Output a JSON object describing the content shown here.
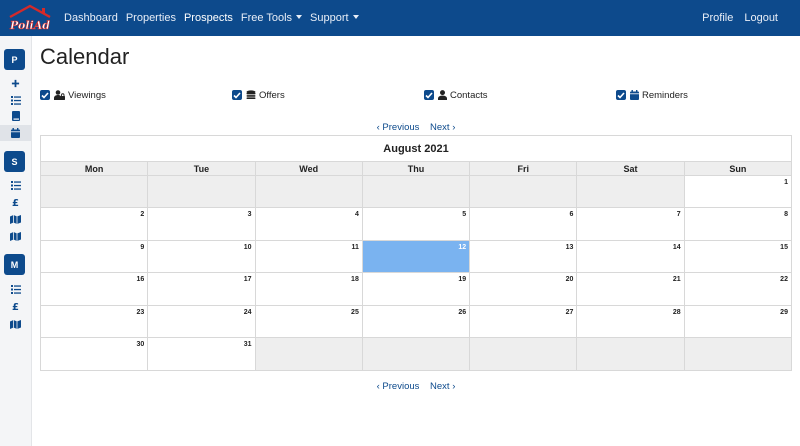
{
  "brand": {
    "logo_text": "PoliAd",
    "accent": "#0d4a8c",
    "logo_color": "#d42a2a"
  },
  "nav": {
    "left": [
      {
        "label": "Dashboard",
        "dropdown": false,
        "active": false
      },
      {
        "label": "Properties",
        "dropdown": false,
        "active": false
      },
      {
        "label": "Prospects",
        "dropdown": false,
        "active": true
      },
      {
        "label": "Free Tools",
        "dropdown": true,
        "active": false
      },
      {
        "label": "Support",
        "dropdown": true,
        "active": false
      }
    ],
    "right": [
      {
        "label": "Profile"
      },
      {
        "label": "Logout"
      }
    ]
  },
  "sidebar": {
    "groups": [
      {
        "label": "P",
        "icons": [
          "plus-icon",
          "list-icon",
          "book-icon",
          "calendar-icon"
        ]
      },
      {
        "label": "S",
        "icons": [
          "list-icon",
          "pound-icon",
          "map-icon",
          "map-icon"
        ]
      },
      {
        "label": "M",
        "icons": [
          "list-icon",
          "pound-icon",
          "map-icon"
        ]
      }
    ],
    "active_icon": "calendar-icon"
  },
  "page": {
    "title": "Calendar"
  },
  "filters": [
    {
      "label": "Viewings",
      "icon": "user-lock-icon",
      "checked": true
    },
    {
      "label": "Offers",
      "icon": "coins-icon",
      "checked": true
    },
    {
      "label": "Contacts",
      "icon": "user-icon",
      "checked": true
    },
    {
      "label": "Reminders",
      "icon": "calendar-icon",
      "checked": true
    }
  ],
  "pager": {
    "prev": "‹ Previous",
    "next": "Next ›"
  },
  "calendar": {
    "month_label": "August 2021",
    "weekdays": [
      "Mon",
      "Tue",
      "Wed",
      "Thu",
      "Fri",
      "Sat",
      "Sun"
    ],
    "weeks": [
      [
        "",
        "",
        "",
        "",
        "",
        "",
        "1"
      ],
      [
        "2",
        "3",
        "4",
        "5",
        "6",
        "7",
        "8"
      ],
      [
        "9",
        "10",
        "11",
        "12",
        "13",
        "14",
        "15"
      ],
      [
        "16",
        "17",
        "18",
        "19",
        "20",
        "21",
        "22"
      ],
      [
        "23",
        "24",
        "25",
        "26",
        "27",
        "28",
        "29"
      ],
      [
        "30",
        "31",
        "",
        "",
        "",
        "",
        ""
      ]
    ],
    "today": "12",
    "colors": {
      "today": "#7ab3f0",
      "empty": "#eeeeee"
    }
  }
}
